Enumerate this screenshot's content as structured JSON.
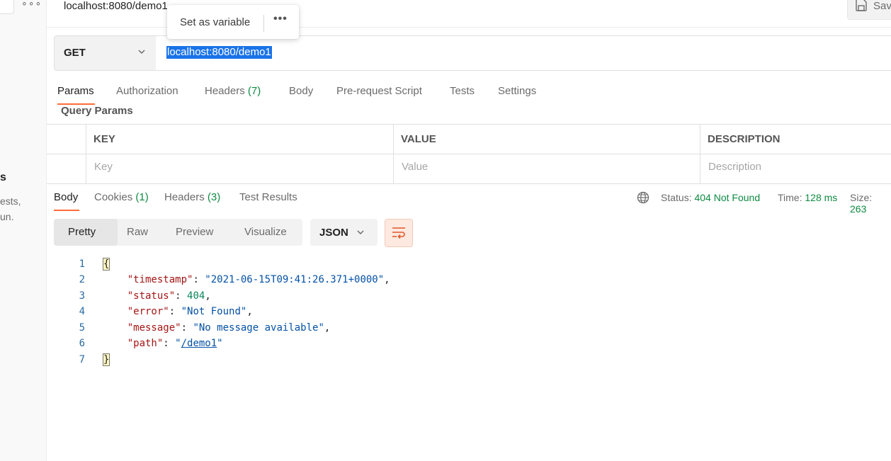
{
  "sidebar": {
    "dots": "∘∘∘",
    "partial_heading": "s",
    "partial_line1": "ests,",
    "partial_line2": "un."
  },
  "header": {
    "request_title": "localhost:8080/demo1",
    "save_label": "Sav"
  },
  "popup": {
    "set_variable_label": "Set as variable",
    "more_label": "•••"
  },
  "request": {
    "method": "GET",
    "url": "localhost:8080/demo1"
  },
  "request_tabs": [
    {
      "label": "Params",
      "count": ""
    },
    {
      "label": "Authorization",
      "count": ""
    },
    {
      "label": "Headers",
      "count": "(7)"
    },
    {
      "label": "Body",
      "count": ""
    },
    {
      "label": "Pre-request Script",
      "count": ""
    },
    {
      "label": "Tests",
      "count": ""
    },
    {
      "label": "Settings",
      "count": ""
    }
  ],
  "query_params": {
    "title": "Query Params",
    "headers": [
      "KEY",
      "VALUE",
      "DESCRIPTION"
    ],
    "placeholders": [
      "Key",
      "Value",
      "Description"
    ]
  },
  "response_tabs": [
    {
      "label": "Body",
      "count": ""
    },
    {
      "label": "Cookies",
      "count": "(1)"
    },
    {
      "label": "Headers",
      "count": "(3)"
    },
    {
      "label": "Test Results",
      "count": ""
    }
  ],
  "response_meta": {
    "status_label": "Status:",
    "status_value": "404 Not Found",
    "time_label": "Time:",
    "time_value": "128 ms",
    "size_label": "Size:",
    "size_value": "263"
  },
  "view_modes": [
    "Pretty",
    "Raw",
    "Preview",
    "Visualize"
  ],
  "format": "JSON",
  "code": {
    "line_numbers": [
      "1",
      "2",
      "3",
      "4",
      "5",
      "6",
      "7"
    ],
    "open_brace": "{",
    "close_brace": "}",
    "entries": [
      {
        "key": "\"timestamp\"",
        "sep": ": ",
        "value": "\"2021-06-15T09:41:26.371+0000\"",
        "trail": ","
      },
      {
        "key": "\"status\"",
        "sep": ": ",
        "value": "404",
        "trail": ","
      },
      {
        "key": "\"error\"",
        "sep": ": ",
        "value": "\"Not Found\"",
        "trail": ","
      },
      {
        "key": "\"message\"",
        "sep": ": ",
        "value": "\"No message available\"",
        "trail": ","
      },
      {
        "key": "\"path\"",
        "sep": ": ",
        "value_q1": "\"",
        "value_link": "/demo1",
        "value_q2": "\""
      }
    ]
  }
}
